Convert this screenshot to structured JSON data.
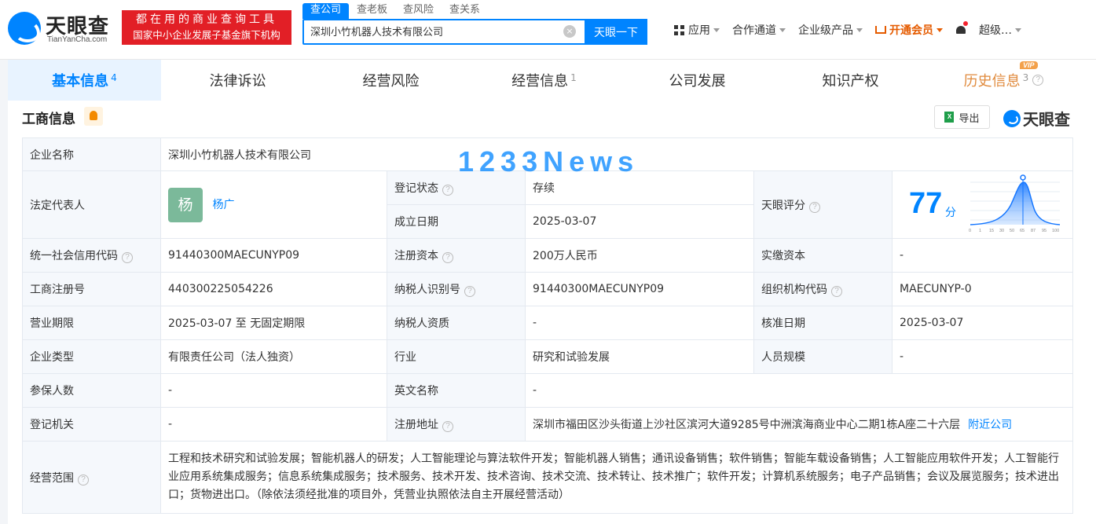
{
  "header": {
    "logo_name": "天眼查",
    "logo_sub": "TianYanCha.com",
    "slogan_line1": "都在用的商业查询工具",
    "slogan_line2": "国家中小企业发展子基金旗下机构",
    "search_tabs": [
      "查公司",
      "查老板",
      "查风险",
      "查关系"
    ],
    "search_value": "深圳小竹机器人技术有限公司",
    "search_button": "天眼一下",
    "nav": {
      "apps": "应用",
      "channel": "合作通道",
      "enterprise": "企业级产品",
      "vip": "开通会员",
      "user": "超级…"
    }
  },
  "tabs": [
    {
      "label": "基本信息",
      "count": "4"
    },
    {
      "label": "法律诉讼",
      "count": ""
    },
    {
      "label": "经营风险",
      "count": ""
    },
    {
      "label": "经营信息",
      "count": "1"
    },
    {
      "label": "公司发展",
      "count": ""
    },
    {
      "label": "知识产权",
      "count": ""
    },
    {
      "label": "历史信息",
      "count": "3",
      "badge": "VIP"
    }
  ],
  "section": {
    "title": "工商信息",
    "export": "导出",
    "brand": "天眼查"
  },
  "info": {
    "company_name_label": "企业名称",
    "company_name": "深圳小竹机器人技术有限公司",
    "legal_rep_label": "法定代表人",
    "legal_rep_avatar": "杨",
    "legal_rep": "杨广",
    "reg_status_label": "登记状态",
    "reg_status": "存续",
    "found_date_label": "成立日期",
    "found_date": "2025-03-07",
    "score_label": "天眼评分",
    "score": "77",
    "score_unit": "分",
    "score_ticks": [
      "0",
      "1",
      "15",
      "30",
      "50",
      "65",
      "87",
      "95",
      "100"
    ],
    "credit_code_label": "统一社会信用代码",
    "credit_code": "91440300MAECUNYP09",
    "reg_capital_label": "注册资本",
    "reg_capital": "200万人民币",
    "paid_capital_label": "实缴资本",
    "paid_capital": "-",
    "reg_no_label": "工商注册号",
    "reg_no": "440300225054226",
    "taxpayer_id_label": "纳税人识别号",
    "taxpayer_id": "91440300MAECUNYP09",
    "org_code_label": "组织机构代码",
    "org_code": "MAECUNYP-0",
    "term_label": "营业期限",
    "term": "2025-03-07 至 无固定期限",
    "taxpayer_qual_label": "纳税人资质",
    "taxpayer_qual": "-",
    "approve_date_label": "核准日期",
    "approve_date": "2025-03-07",
    "type_label": "企业类型",
    "type": "有限责任公司（法人独资）",
    "industry_label": "行业",
    "industry": "研究和试验发展",
    "staff_label": "人员规模",
    "staff": "-",
    "insured_label": "参保人数",
    "insured": "-",
    "english_name_label": "英文名称",
    "english_name": "-",
    "authority_label": "登记机关",
    "authority": "-",
    "address_label": "注册地址",
    "address": "深圳市福田区沙头街道上沙社区滨河大道9285号中洲滨海商业中心二期1栋A座二十六层",
    "nearby": "附近公司",
    "scope_label": "经营范围",
    "scope": "工程和技术研究和试验发展；智能机器人的研发；人工智能理论与算法软件开发；智能机器人销售；通讯设备销售；软件销售；智能车载设备销售；人工智能应用软件开发；人工智能行业应用系统集成服务；信息系统集成服务；技术服务、技术开发、技术咨询、技术交流、技术转让、技术推广；软件开发；计算机系统服务；电子产品销售；会议及展览服务；技术进出口；货物进出口。（除依法须经批准的项目外，凭营业执照依法自主开展经营活动）"
  },
  "watermark": "1233News"
}
